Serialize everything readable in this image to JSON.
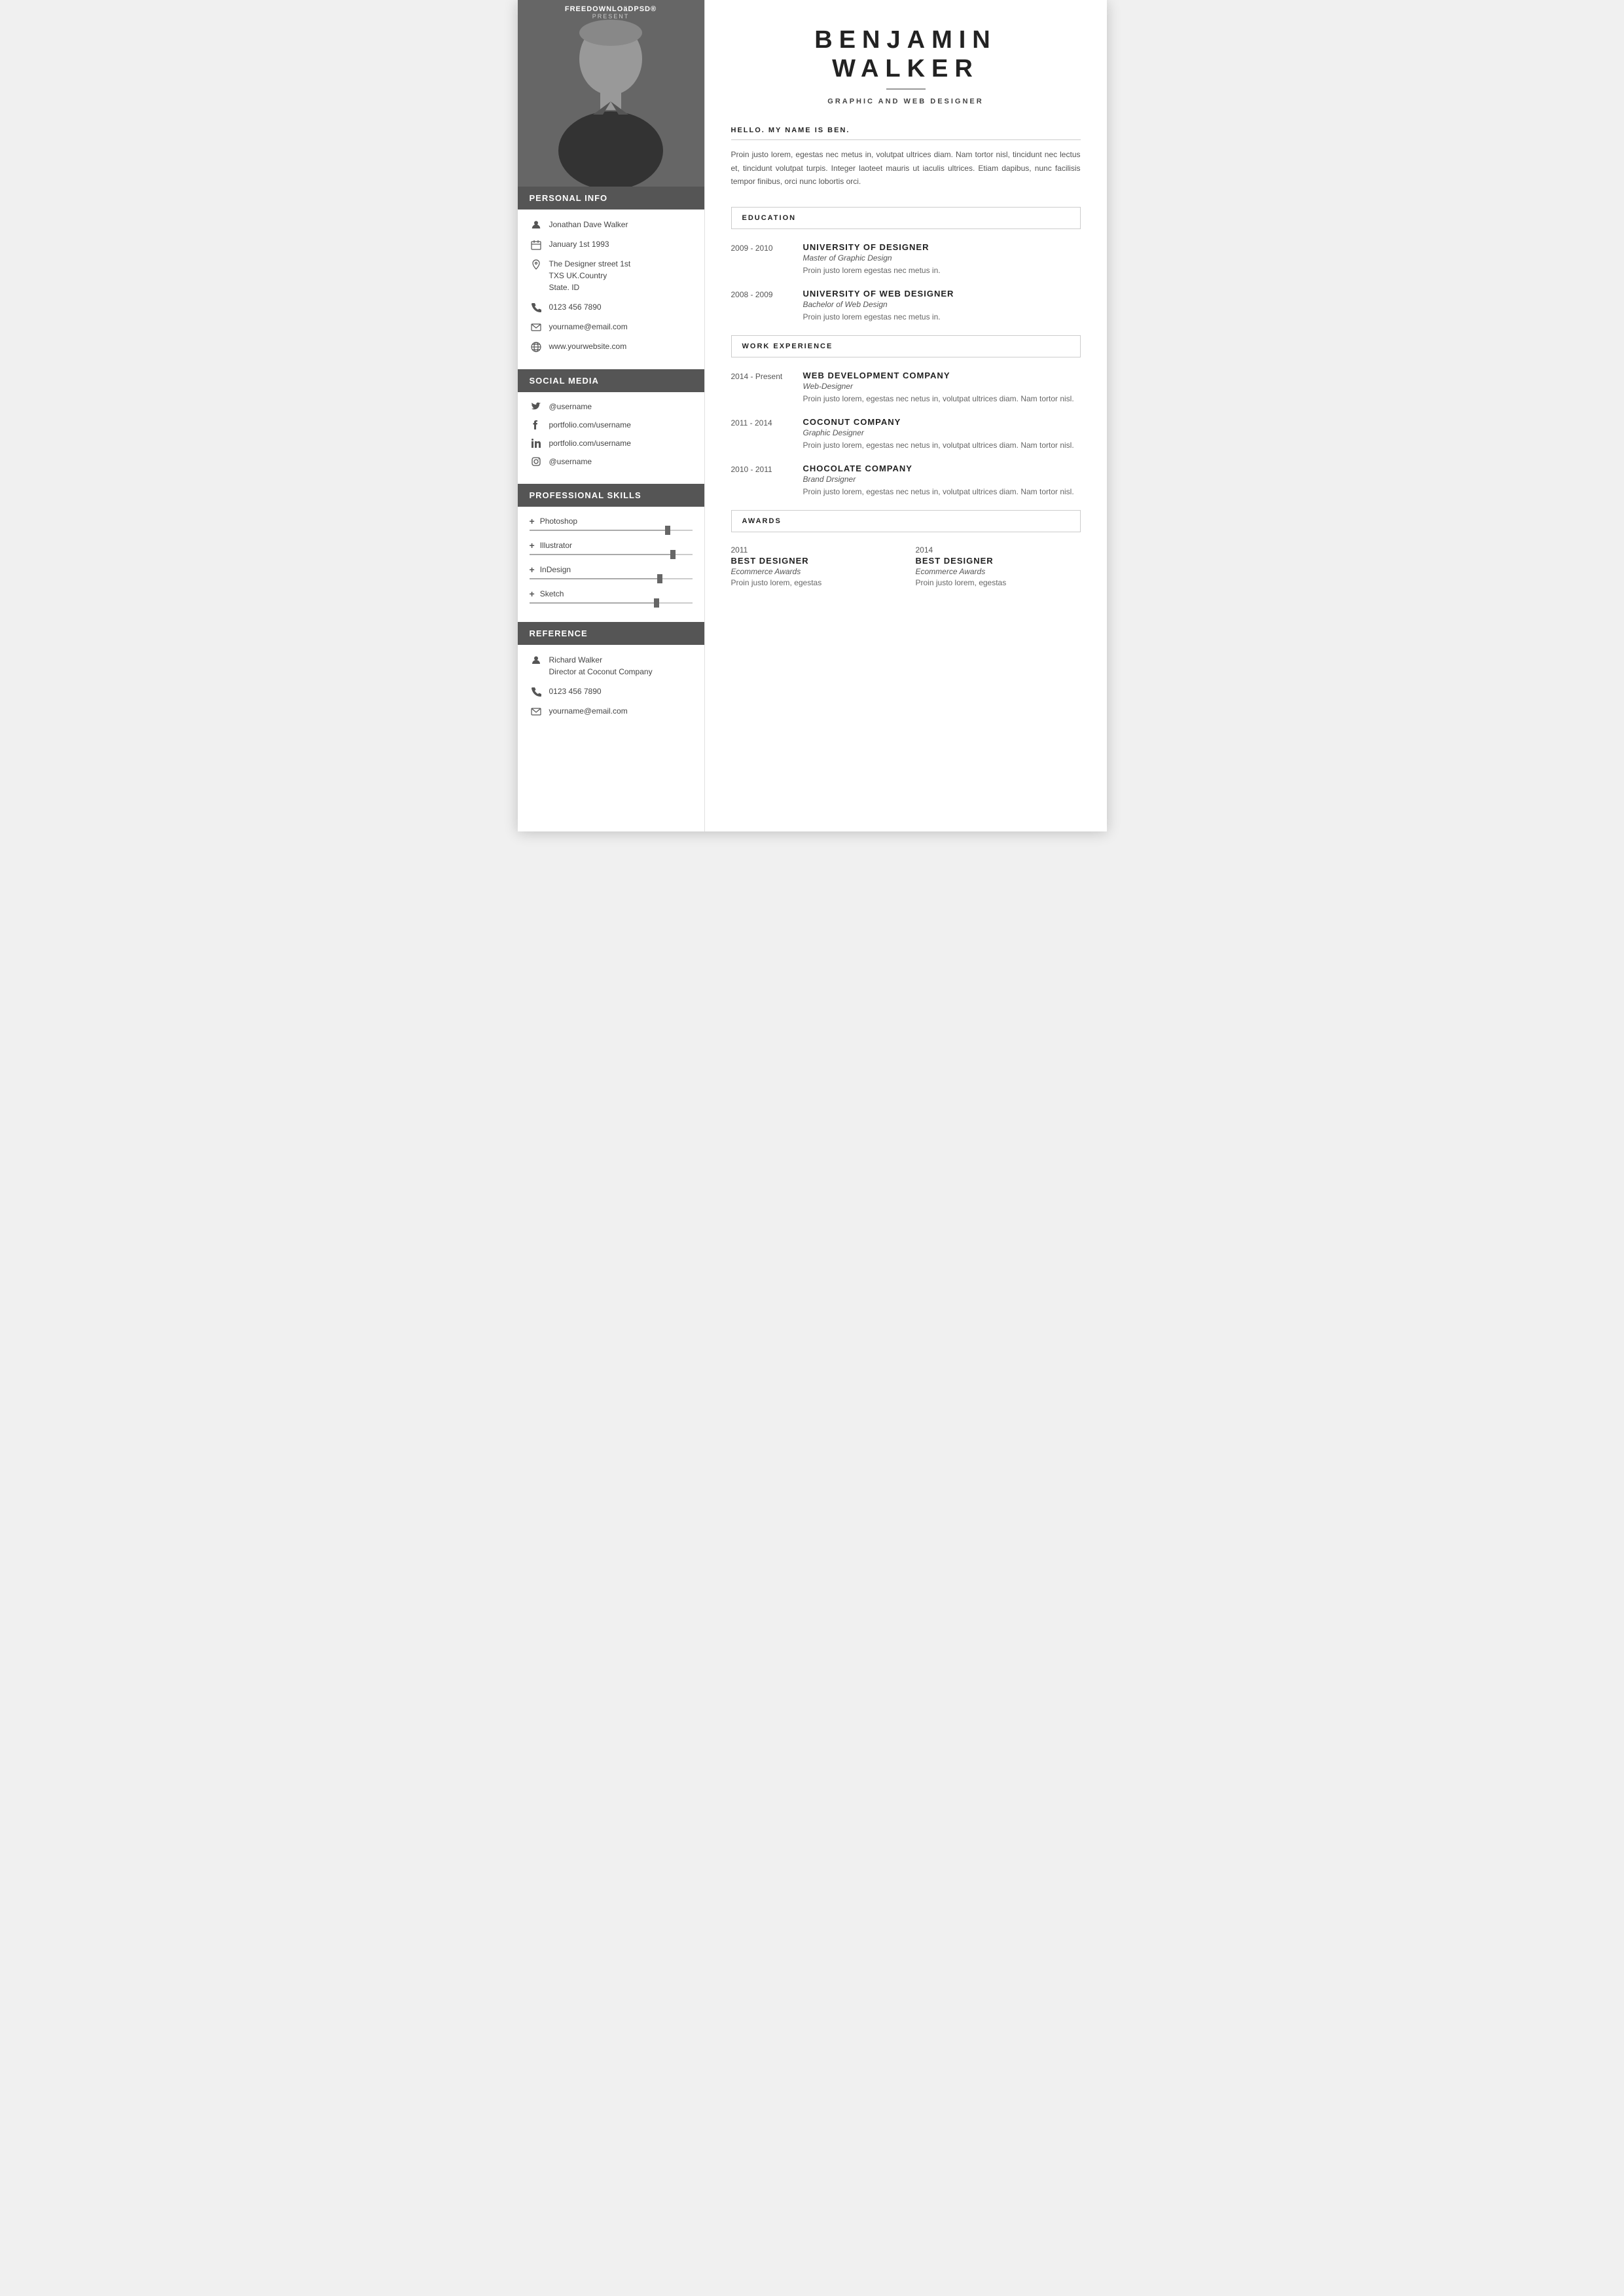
{
  "brand": {
    "name": "FREEDOWNLOäDPSD®",
    "tagline": "PRESENT"
  },
  "header": {
    "first_name": "BENJAMIN",
    "last_name": "WALKER",
    "title": "GRAPHIC AND WEB DESIGNER"
  },
  "intro": {
    "greeting": "HELLO. MY NAME IS BEN.",
    "body": "Proin justo lorem, egestas nec metus in, volutpat ultrices diam. Nam tortor nisl, tincidunt nec lectus et, tincidunt volutpat turpis. Integer laoteet mauris ut iaculis ultrices. Etiam dapibus, nunc facilisis tempor finibus, orci nunc lobortis orci."
  },
  "personal_info": {
    "section_title": "PERSONAL INFO",
    "name": "Jonathan Dave Walker",
    "dob": "January 1st 1993",
    "address_line1": "The Designer street 1st",
    "address_line2": "TXS UK.Country",
    "address_line3": "State. ID",
    "phone": "0123 456 7890",
    "email": "yourname@email.com",
    "website": "www.yourwebsite.com"
  },
  "social_media": {
    "section_title": "SOCIAL MEDIA",
    "items": [
      {
        "icon": "twitter",
        "label": "@username"
      },
      {
        "icon": "facebook",
        "label": "portfolio.com/username"
      },
      {
        "icon": "linkedin",
        "label": "portfolio.com/username"
      },
      {
        "icon": "instagram",
        "label": "@username"
      }
    ]
  },
  "skills": {
    "section_title": "PROFESSIONAL  SKILLS",
    "items": [
      {
        "name": "Photoshop",
        "percent": 85
      },
      {
        "name": "Illustrator",
        "percent": 88
      },
      {
        "name": "InDesign",
        "percent": 80
      },
      {
        "name": "Sketch",
        "percent": 78
      }
    ]
  },
  "reference": {
    "section_title": "REFERENCE",
    "name": "Richard Walker",
    "role": "Director at Coconut Company",
    "phone": "0123 456 7890",
    "email": "yourname@email.com"
  },
  "education": {
    "section_title": "EDUCATION",
    "entries": [
      {
        "years": "2009 - 2010",
        "institution": "UNIVERSITY OF DESIGNER",
        "degree": "Master of Graphic Design",
        "desc": "Proin justo lorem egestas nec metus in."
      },
      {
        "years": "2008 - 2009",
        "institution": "UNIVERSITY OF WEB DESIGNER",
        "degree": "Bachelor of Web Design",
        "desc": "Proin justo lorem egestas nec metus in."
      }
    ]
  },
  "work_experience": {
    "section_title": "WORK EXPERIENCE",
    "entries": [
      {
        "years": "2014 - Present",
        "company": "WEB DEVELOPMENT COMPANY",
        "role": "Web-Designer",
        "desc": "Proin justo lorem, egestas nec netus in, volutpat ultrices diam. Nam tortor nisl."
      },
      {
        "years": "2011 - 2014",
        "company": "COCONUT COMPANY",
        "role": "Graphic Designer",
        "desc": "Proin justo lorem, egestas nec netus in, volutpat ultrices diam. Nam tortor nisl."
      },
      {
        "years": "2010 - 2011",
        "company": "CHOCOLATE  COMPANY",
        "role": "Brand Drsigner",
        "desc": "Proin justo lorem, egestas nec netus in, volutpat ultrices diam. Nam tortor nisl."
      }
    ]
  },
  "awards": {
    "section_title": "AWARDS",
    "items": [
      {
        "year": "2011",
        "title": "BEST  DESIGNER",
        "org": "Ecommerce Awards",
        "desc": "Proin justo lorem, egestas"
      },
      {
        "year": "2014",
        "title": "BEST  DESIGNER",
        "org": "Ecommerce Awards",
        "desc": "Proin justo lorem, egestas"
      }
    ]
  }
}
